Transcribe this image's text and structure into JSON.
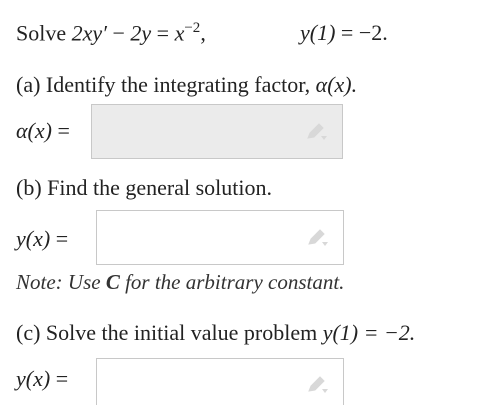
{
  "problem": {
    "solve_word": "Solve",
    "lhs1": "2xy′",
    "minus": "−",
    "lhs2": "2y",
    "equals": "=",
    "rhs_base": "x",
    "rhs_exp": "−2",
    "comma": ",",
    "ic_lhs": "y(1)",
    "ic_rhs": "−2."
  },
  "parts": {
    "a": {
      "prompt_text": "(a) Identify the integrating factor,",
      "prompt_math": "α(x).",
      "label": "α(x)",
      "equals": "=",
      "input_value": ""
    },
    "b": {
      "prompt_text": "(b) Find the general solution.",
      "label": "y(x)",
      "equals": "=",
      "input_value": "",
      "note_prefix": "Note: Use",
      "note_var": "C",
      "note_suffix": "for the arbitrary constant."
    },
    "c": {
      "prompt_text": "(c) Solve the initial value problem",
      "prompt_math": "y(1) = −2.",
      "label": "y(x)",
      "equals": "=",
      "input_value": ""
    }
  }
}
